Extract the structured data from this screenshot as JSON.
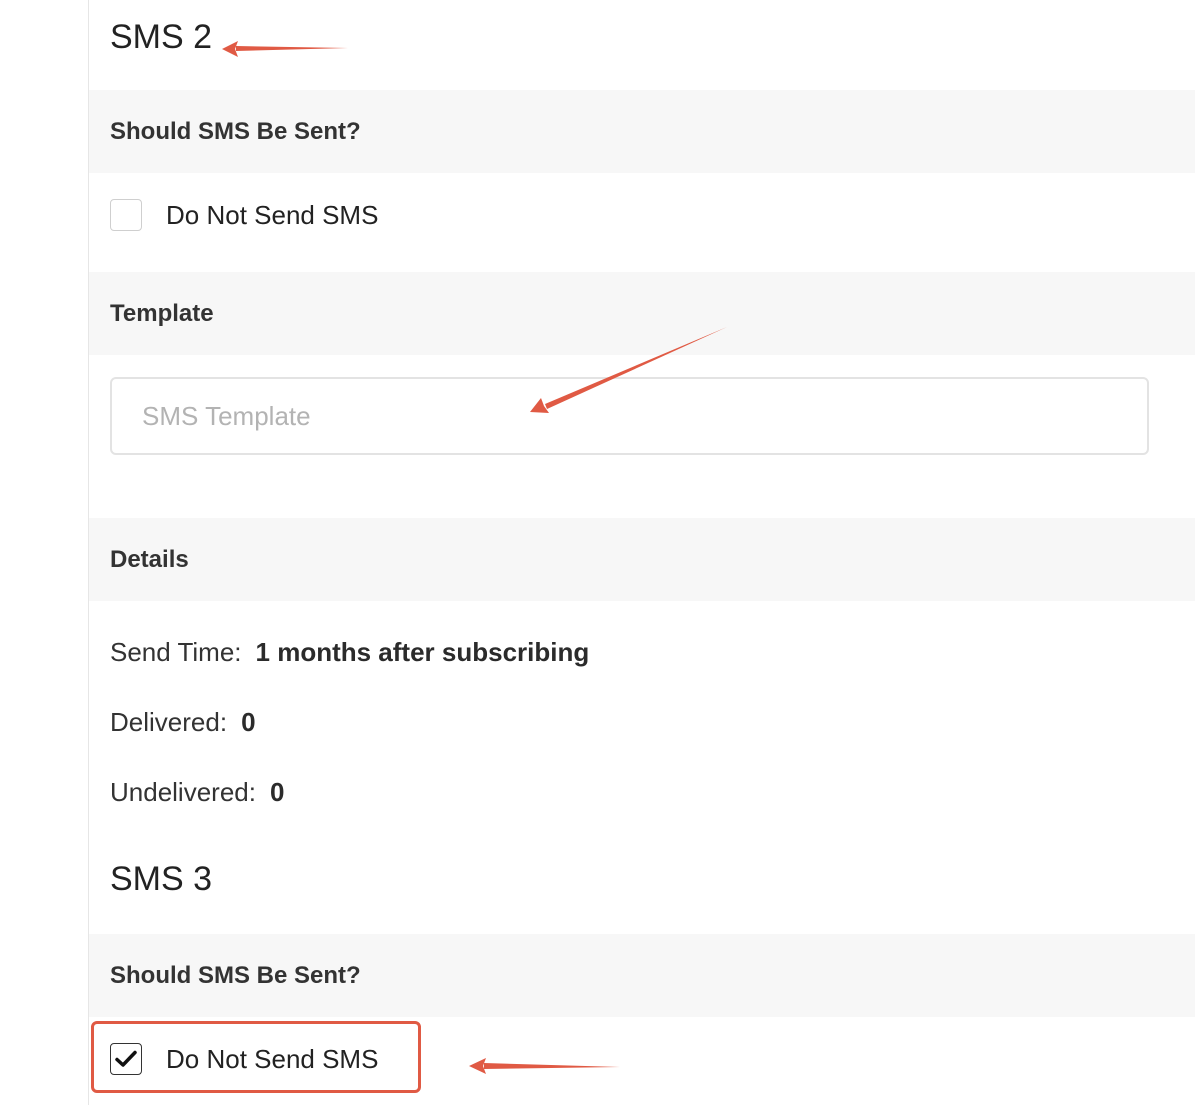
{
  "sms2": {
    "heading": "SMS 2",
    "should_send_label": "Should SMS Be Sent?",
    "do_not_send": {
      "label": "Do Not Send SMS",
      "checked": false
    },
    "template_section_label": "Template",
    "template_input": {
      "placeholder": "SMS Template",
      "value": ""
    },
    "details_section_label": "Details",
    "details": {
      "send_time_key": "Send Time:",
      "send_time_value": "1 months after subscribing",
      "delivered_key": "Delivered:",
      "delivered_value": "0",
      "undelivered_key": "Undelivered:",
      "undelivered_value": "0"
    }
  },
  "sms3": {
    "heading": "SMS 3",
    "should_send_label": "Should SMS Be Sent?",
    "do_not_send": {
      "label": "Do Not Send SMS",
      "checked": true
    }
  },
  "annotations": {
    "arrow_color": "#e05a44",
    "highlight_color": "#e05a44"
  }
}
